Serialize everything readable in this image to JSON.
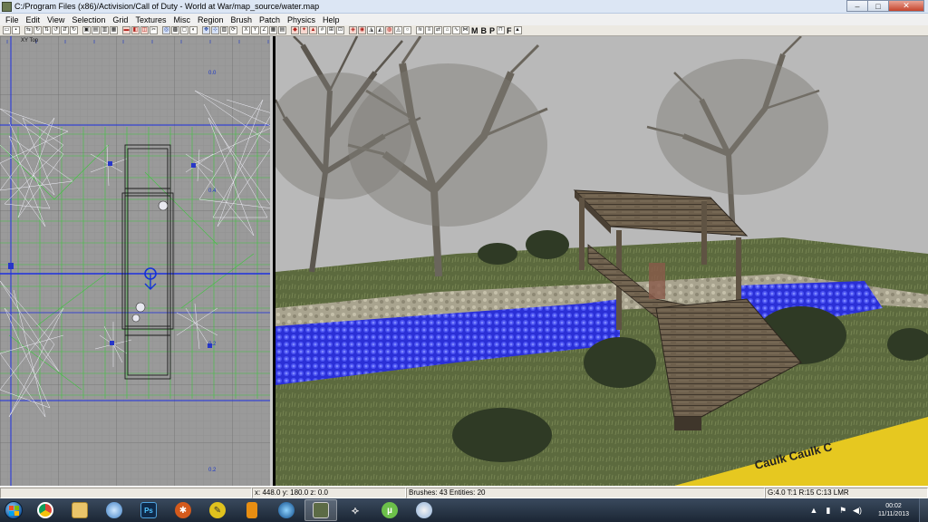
{
  "window": {
    "title": "C:/Program Files (x86)/Activision/Call of Duty - World at War/map_source/water.map",
    "minimize_label": "–",
    "maximize_label": "□",
    "close_label": "✕",
    "icon": "radiant-app-icon"
  },
  "menu": {
    "items": [
      "File",
      "Edit",
      "View",
      "Selection",
      "Grid",
      "Textures",
      "Misc",
      "Region",
      "Brush",
      "Patch",
      "Physics",
      "Help"
    ]
  },
  "toolbar": {
    "letters": [
      "M",
      "B",
      "P",
      "F"
    ]
  },
  "grid_view": {
    "view_label": "XY Top",
    "coords": [
      "0.0",
      "0.4",
      "0.2",
      "0.2"
    ]
  },
  "camera": {
    "caulk_text": "Caulk Caulk C",
    "colors": {
      "sky": "#b9b9b9",
      "water": "#2c2fd8",
      "grass": "#5e6b3f",
      "wood": "#6e5f4c"
    }
  },
  "status": {
    "coords": "x: 448.0  y: 180.0  z: 0.0",
    "counts": "Brushes: 43  Entities: 20",
    "grid_info": "G:4.0 T:1 R:15 C:13 LMR"
  },
  "taskbar": {
    "apps": [
      "chrome-icon",
      "explorer-folder-icon",
      "media-icon",
      "photoshop-icon",
      "radiant-icon",
      "utility-icon",
      "lock-icon",
      "disc-icon",
      "cod-icon",
      "skyrim-icon",
      "utorrent-icon",
      "paint-icon"
    ],
    "photoshop_label": "Ps",
    "clock_time": "00:02",
    "clock_date": "11/11/2013"
  }
}
